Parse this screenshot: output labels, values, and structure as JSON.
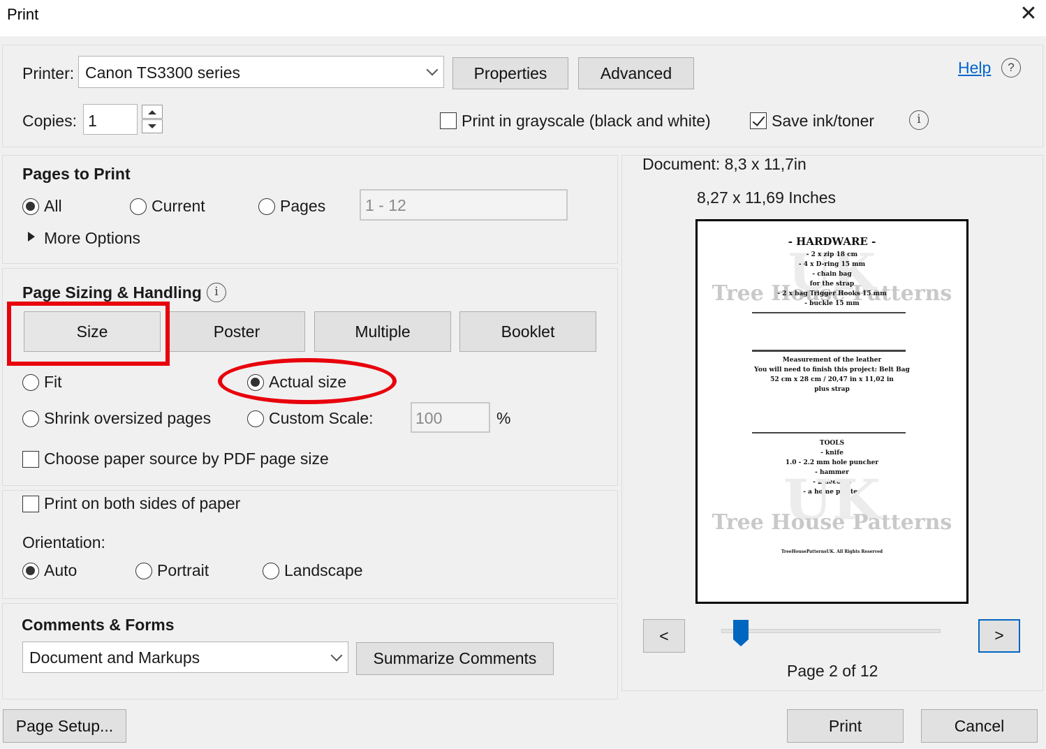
{
  "window": {
    "title": "Print",
    "close_icon": "close-icon"
  },
  "printer": {
    "label": "Printer:",
    "selected": "Canon TS3300 series",
    "properties_label": "Properties",
    "advanced_label": "Advanced",
    "help_label": "Help"
  },
  "copies": {
    "label": "Copies:",
    "value": "1"
  },
  "options": {
    "grayscale_label": "Print in grayscale (black and white)",
    "grayscale_checked": false,
    "save_ink_label": "Save ink/toner",
    "save_ink_checked": true
  },
  "pages_to_print": {
    "heading": "Pages to Print",
    "all_label": "All",
    "current_label": "Current",
    "pages_label": "Pages",
    "pages_range": "1 - 12",
    "more_options_label": "More Options",
    "selected": "All"
  },
  "page_sizing": {
    "heading": "Page Sizing & Handling",
    "tabs": [
      "Size",
      "Poster",
      "Multiple",
      "Booklet"
    ],
    "active_tab": "Size",
    "fit_label": "Fit",
    "actual_size_label": "Actual size",
    "shrink_label": "Shrink oversized pages",
    "custom_scale_label": "Custom Scale:",
    "custom_scale_value": "100",
    "percent_label": "%",
    "selected": "Actual size",
    "paper_source_label": "Choose paper source by PDF page size",
    "paper_source_checked": false
  },
  "duplex": {
    "both_sides_label": "Print on both sides of paper",
    "both_sides_checked": false,
    "orientation_label": "Orientation:",
    "auto_label": "Auto",
    "portrait_label": "Portrait",
    "landscape_label": "Landscape",
    "selected": "Auto"
  },
  "comments_forms": {
    "heading": "Comments & Forms",
    "selected": "Document and Markups",
    "summarize_label": "Summarize Comments"
  },
  "preview": {
    "document_size": "Document: 8,3 x 11,7in",
    "paper_size": "8,27 x 11,69 Inches",
    "prev_label": "<",
    "next_label": ">",
    "page_status": "Page 2 of 12",
    "slider_position": 0.09,
    "page": {
      "hardware_title": "- HARDWARE -",
      "hardware_items": [
        "- 2 x zip 18 cm",
        "- 4 x D-ring 15 mm",
        "- chain bag",
        "for the strap",
        "- 2 x bag Trigger Hooks 15 mm",
        "- buckle 15 mm"
      ],
      "measurement_lines": [
        "Measurement of the leather",
        "You will need to finish this project: Belt Bag",
        "52 cm x 28 cm / 20,47 in x 11,02 in",
        "plus strap"
      ],
      "tools_title": "TOOLS",
      "tools_items": [
        "- knife",
        "1.0 - 2.2 mm hole puncher",
        "- hammer",
        "- 2 needles",
        "- a home printer"
      ],
      "watermark": "Tree House Patterns",
      "watermark_small": "UK",
      "footer": "TreeHousePatternsUK. All Rights Reserved"
    }
  },
  "footer": {
    "page_setup_label": "Page Setup...",
    "print_label": "Print",
    "cancel_label": "Cancel"
  },
  "colors": {
    "annotation_red": "#e8000b",
    "link_blue": "#0066cc",
    "focus_blue": "#0067c0"
  }
}
